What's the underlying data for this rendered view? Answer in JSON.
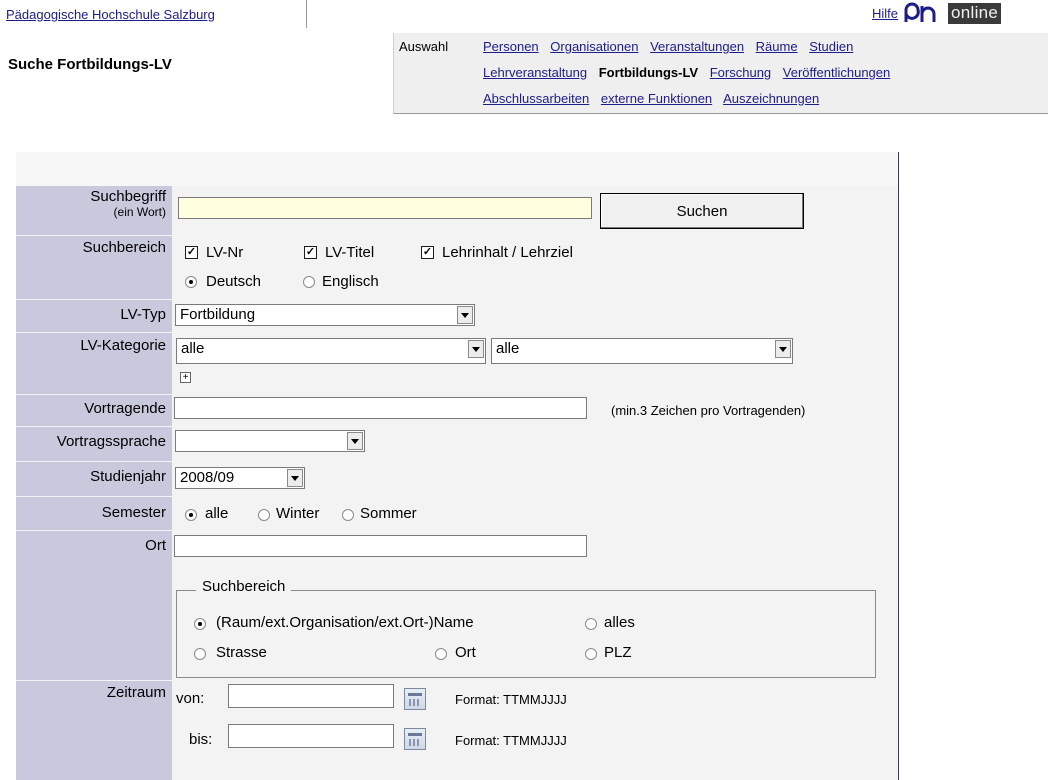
{
  "topbar": {
    "org_link": "Pädagogische Hochschule Salzburg",
    "help": "Hilfe",
    "logo_text": "online"
  },
  "page": {
    "title": "Suche Fortbildungs-LV"
  },
  "nav": {
    "label": "Auswahl",
    "row1": [
      "Personen",
      "Organisationen",
      "Veranstaltungen",
      "Räume",
      "Studien"
    ],
    "row2_a": "Lehrveranstaltung",
    "row2_current": "Fortbildungs-LV",
    "row2_b": [
      "Forschung",
      "Veröffentlichungen"
    ],
    "row3": [
      "Abschlussarbeiten",
      "externe Funktionen",
      "Auszeichnungen"
    ]
  },
  "form": {
    "suchbegriff": {
      "label": "Suchbegriff",
      "sublabel": "(ein Wort)",
      "value": "",
      "button": "Suchen"
    },
    "suchbereich": {
      "label": "Suchbereich",
      "checks": [
        {
          "text": "LV-Nr",
          "checked": true
        },
        {
          "text": "LV-Titel",
          "checked": true
        },
        {
          "text": "Lehrinhalt / Lehrziel",
          "checked": true
        }
      ],
      "lang": [
        "Deutsch",
        "Englisch"
      ],
      "lang_selected": "Deutsch"
    },
    "lvtyp": {
      "label": "LV-Typ",
      "value": "Fortbildung"
    },
    "lvkategorie": {
      "label": "LV-Kategorie",
      "value1": "alle",
      "value2": "alle"
    },
    "vortragende": {
      "label": "Vortragende",
      "value": "",
      "hint": "(min.3 Zeichen pro Vortragenden)"
    },
    "vortragssprache": {
      "label": "Vortragssprache",
      "value": ""
    },
    "studienjahr": {
      "label": "Studienjahr",
      "value": "2008/09"
    },
    "semester": {
      "label": "Semester",
      "options": [
        "alle",
        "Winter",
        "Sommer"
      ],
      "selected": "alle"
    },
    "ort": {
      "label": "Ort",
      "value": "",
      "legend": "Suchbereich",
      "options": [
        "(Raum/ext.Organisation/ext.Ort-)Name",
        "alles",
        "Strasse",
        "Ort",
        "PLZ"
      ],
      "selected": "(Raum/ext.Organisation/ext.Ort-)Name"
    },
    "zeitraum": {
      "label": "Zeitraum",
      "von": "von:",
      "bis": "bis:",
      "format": "Format: TTMMJJJJ"
    }
  },
  "colors": {
    "link": "#1c1c8c",
    "label_col": "#c9c9dd",
    "panel": "#f3f3f3",
    "nav_bg": "#efefef"
  }
}
